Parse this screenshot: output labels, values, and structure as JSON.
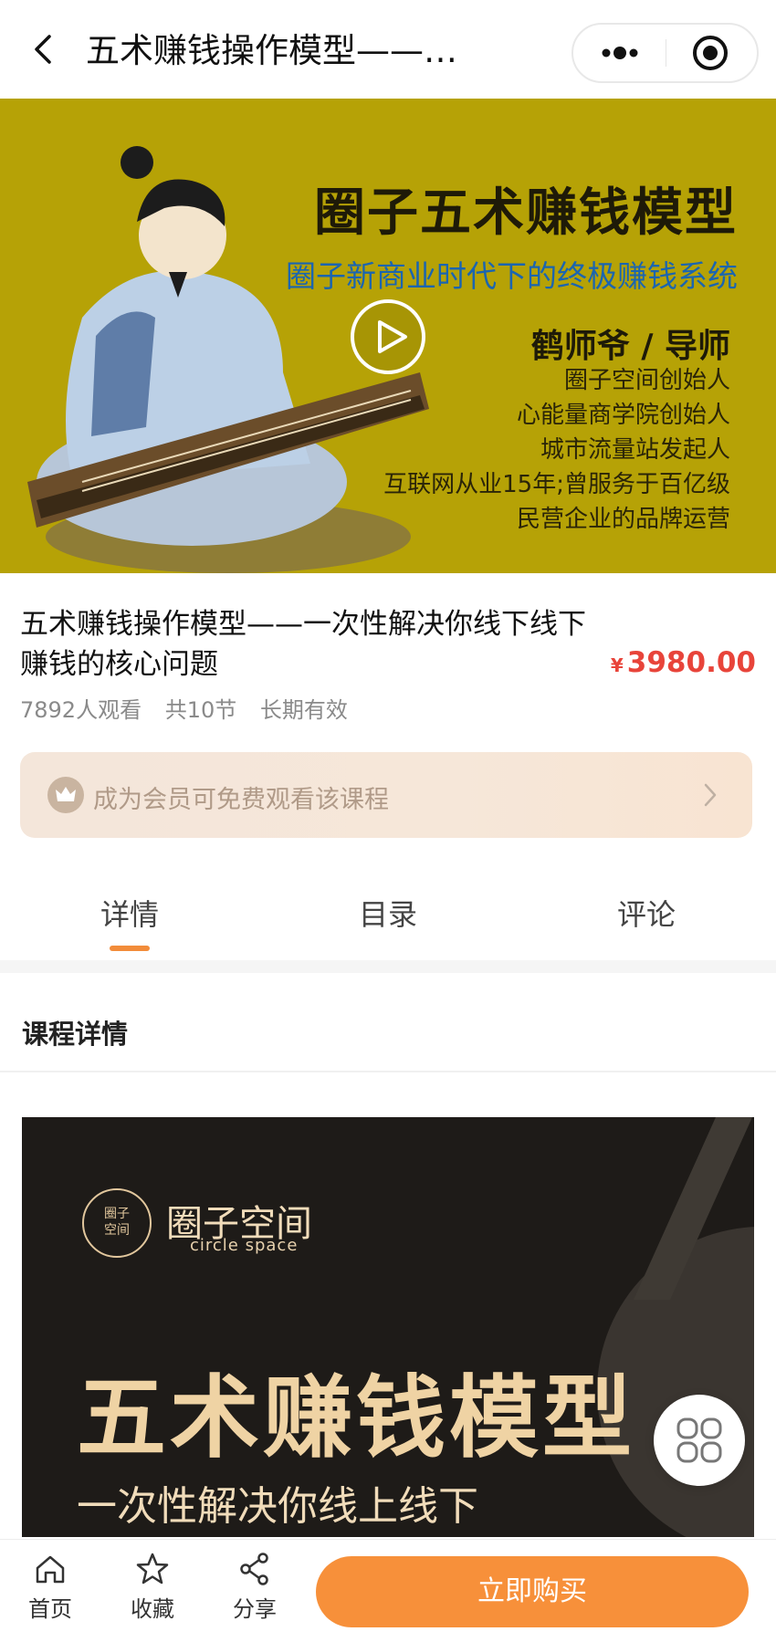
{
  "nav": {
    "title": "五术赚钱操作模型——…",
    "more_icon": "more-dots-icon",
    "close_icon": "target-close-icon"
  },
  "hero": {
    "title": "圈子五术赚钱模型",
    "subtitle": "圈子新商业时代下的终极赚钱系统",
    "teacher": "鹤师爷 / 导师",
    "bio": [
      "圈子空间创始人",
      "心能量商学院创始人",
      "城市流量站发起人",
      "互联网从业15年;曾服务于百亿级",
      "民营企业的品牌运营"
    ],
    "bg_color": "#b6a206"
  },
  "course": {
    "title": "五术赚钱操作模型——一次性解决你线下线下赚钱的核心问题",
    "price_symbol": "¥",
    "price": "3980.00",
    "views": "7892人观看",
    "lessons": "共10节",
    "validity": "长期有效"
  },
  "member": {
    "text": "成为会员可免费观看该课程"
  },
  "tabs": [
    "详情",
    "目录",
    "评论"
  ],
  "active_tab": 0,
  "section": {
    "title": "课程详情"
  },
  "poster": {
    "brand": "圈子空间",
    "brand_en": "circle space",
    "title": "五术赚钱模型",
    "subtitle": "一次性解决你线上线下"
  },
  "bottom": {
    "home": "首页",
    "favorite": "收藏",
    "share": "分享",
    "buy": "立即购买"
  },
  "colors": {
    "accent": "#f7903a",
    "price": "#e8443a",
    "tab_indicator": "#f28c3a"
  }
}
